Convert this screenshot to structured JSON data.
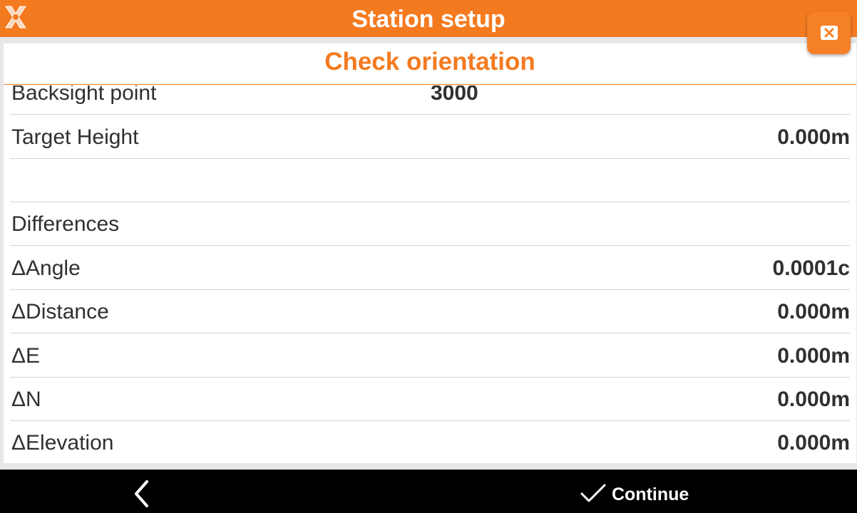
{
  "app": {
    "title": "Station setup",
    "logo_icon": "x-logo-icon",
    "accent_color": "#f47a20"
  },
  "dialog": {
    "title": "Check orientation",
    "close_icon": "close-icon"
  },
  "rows": [
    {
      "label": "Backsight point",
      "value": "3000"
    },
    {
      "label": "Target Height",
      "value": "0.000m"
    },
    {
      "label": "",
      "value": ""
    },
    {
      "label": "Differences",
      "value": ""
    },
    {
      "label": "ΔAngle",
      "value": "0.0001c"
    },
    {
      "label": "ΔDistance",
      "value": "0.000m"
    },
    {
      "label": "ΔE",
      "value": "0.000m"
    },
    {
      "label": "ΔN",
      "value": "0.000m"
    },
    {
      "label": "ΔElevation",
      "value": "0.000m"
    }
  ],
  "bottom_bar": {
    "back_icon": "chevron-left-icon",
    "continue_icon": "check-icon",
    "continue_label": "Continue"
  }
}
